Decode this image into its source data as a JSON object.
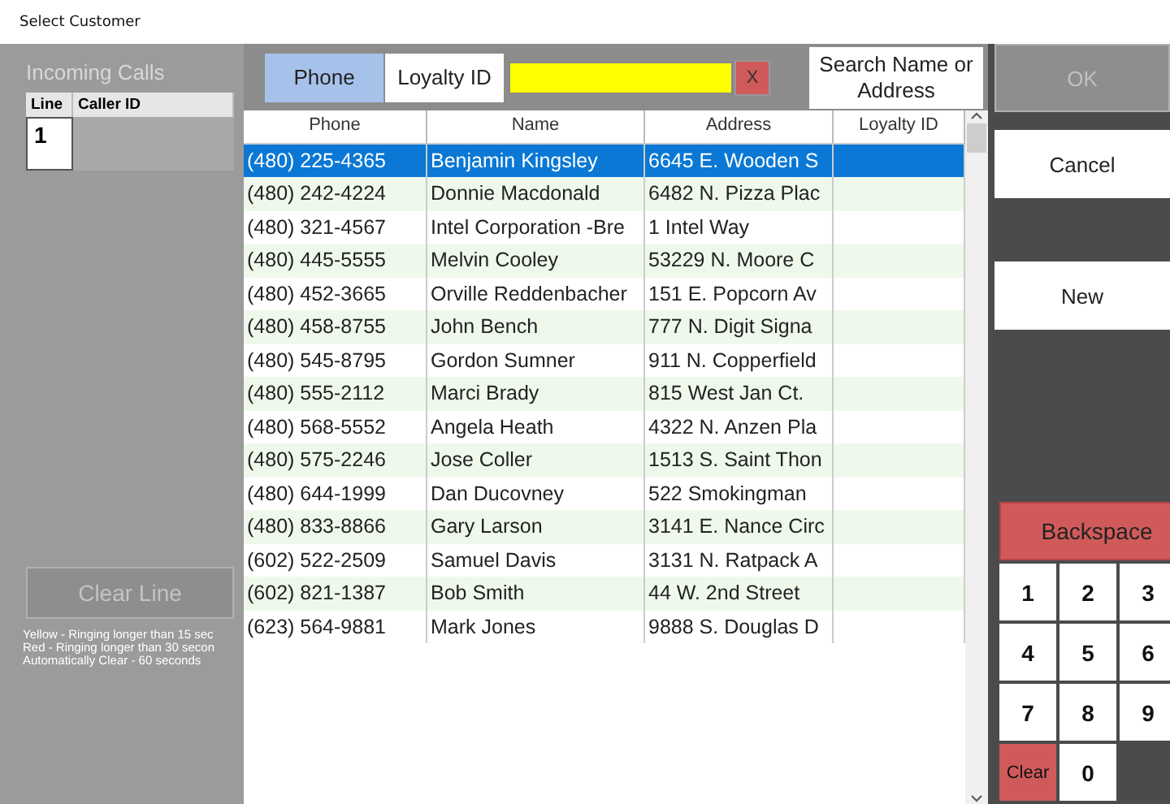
{
  "window": {
    "title": "Select Customer"
  },
  "incoming_calls": {
    "title": "Incoming Calls",
    "columns": [
      "Line",
      "Caller ID"
    ],
    "rows": [
      {
        "line": "1"
      }
    ],
    "clear_button": {
      "label": "Clear Line",
      "disabled": true
    },
    "legend": [
      "Yellow - Ringing longer than 15 sec",
      "Red - Ringing longer than 30 secon",
      "Automatically Clear - 60 seconds"
    ]
  },
  "search_tabs": [
    {
      "label": "Phone",
      "selected": true
    },
    {
      "label": "Loyalty ID",
      "selected": false
    }
  ],
  "search_clear": "X",
  "search_name_button": "Search Name or Address",
  "table": {
    "columns": [
      "Phone",
      "Name",
      "Address",
      "Loyalty ID"
    ],
    "rows": [
      {
        "phone": "(480) 225-4365",
        "name": "Benjamin Kingsley",
        "address": "6645 E. Wooden S",
        "selected": true
      },
      {
        "phone": "(480) 242-4224",
        "name": "Donnie Macdonald",
        "address": "6482 N. Pizza Plac",
        "selected": false
      },
      {
        "phone": "(480) 321-4567",
        "name": "Intel Corporation -Bre",
        "address": "1 Intel Way",
        "selected": false
      },
      {
        "phone": "(480) 445-5555",
        "name": "Melvin Cooley",
        "address": "53229 N. Moore C",
        "selected": false
      },
      {
        "phone": "(480) 452-3665",
        "name": "Orville Reddenbacher",
        "address": "151 E. Popcorn Av",
        "selected": false
      },
      {
        "phone": "(480) 458-8755",
        "name": "John Bench",
        "address": "777 N. Digit Signa",
        "selected": false
      },
      {
        "phone": "(480) 545-8795",
        "name": "Gordon Sumner",
        "address": "911 N. Copperfield",
        "selected": false
      },
      {
        "phone": "(480) 555-2112",
        "name": "Marci Brady",
        "address": "815 West Jan Ct.",
        "selected": false
      },
      {
        "phone": "(480) 568-5552",
        "name": "Angela Heath",
        "address": "4322 N. Anzen Pla",
        "selected": false
      },
      {
        "phone": "(480) 575-2246",
        "name": "Jose Coller",
        "address": "1513 S. Saint Thon",
        "selected": false
      },
      {
        "phone": "(480) 644-1999",
        "name": "Dan Ducovney",
        "address": "522 Smokingman",
        "selected": false
      },
      {
        "phone": "(480) 833-8866",
        "name": "Gary Larson",
        "address": "3141 E. Nance Circ",
        "selected": false
      },
      {
        "phone": "(602) 522-2509",
        "name": "Samuel Davis",
        "address": "3131 N. Ratpack A",
        "selected": false
      },
      {
        "phone": "(602) 821-1387",
        "name": "Bob Smith",
        "address": "44 W. 2nd Street",
        "selected": false
      },
      {
        "phone": "(623) 564-9881",
        "name": "Mark Jones",
        "address": "9888 S. Douglas D",
        "selected": false
      }
    ]
  },
  "actions": [
    {
      "label": "OK",
      "disabled": true
    },
    {
      "label": "Cancel",
      "disabled": false
    },
    {
      "label": "New",
      "disabled": false
    }
  ],
  "keypad": {
    "backspace": "Backspace",
    "keys": [
      {
        "label": "1",
        "kind": "digit"
      },
      {
        "label": "2",
        "kind": "digit"
      },
      {
        "label": "3",
        "kind": "digit"
      },
      {
        "label": "4",
        "kind": "digit"
      },
      {
        "label": "5",
        "kind": "digit"
      },
      {
        "label": "6",
        "kind": "digit"
      },
      {
        "label": "7",
        "kind": "digit"
      },
      {
        "label": "8",
        "kind": "digit"
      },
      {
        "label": "9",
        "kind": "digit"
      },
      {
        "label": "Clear",
        "kind": "clear"
      },
      {
        "label": "0",
        "kind": "digit"
      }
    ]
  }
}
